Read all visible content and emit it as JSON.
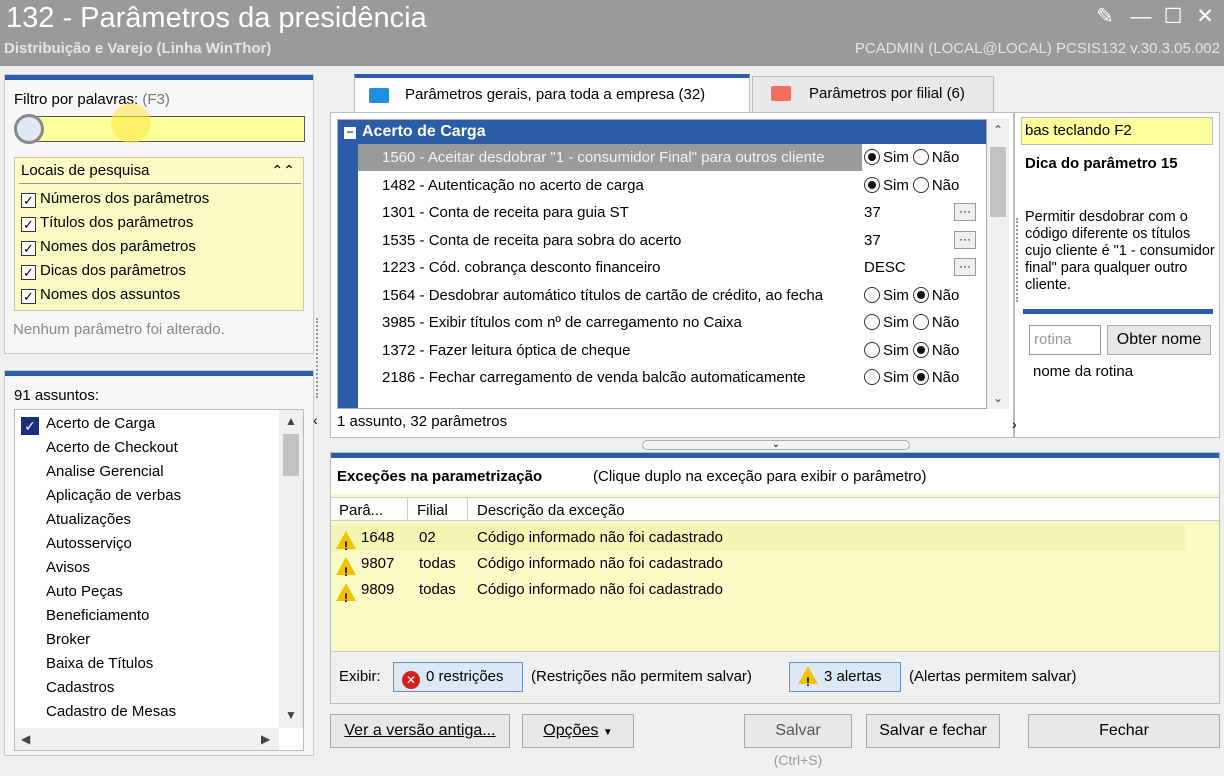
{
  "window": {
    "title": "132 - Parâmetros da presidência",
    "subtitle": "Distribuição e Varejo (Linha WinThor)",
    "info": "PCADMIN (LOCAL@LOCAL)   PCSIS132  v.30.3.05.002"
  },
  "filter": {
    "label": "Filtro por palavras:",
    "shortcut": "(F3)",
    "value": ""
  },
  "search_locations": {
    "title": "Locais de pesquisa",
    "items": [
      {
        "label": "Números dos parâmetros",
        "checked": true
      },
      {
        "label": "Títulos dos parâmetros",
        "checked": true
      },
      {
        "label": "Nomes dos parâmetros",
        "checked": true
      },
      {
        "label": "Dicas dos parâmetros",
        "checked": true
      },
      {
        "label": "Nomes dos assuntos",
        "checked": true
      }
    ]
  },
  "status_msg": "Nenhum parâmetro foi alterado.",
  "subjects": {
    "count_label": "91 assuntos:",
    "items": [
      "Acerto de Carga",
      "Acerto de Checkout",
      "Analise Gerencial",
      "Aplicação de verbas",
      "Atualizações",
      "Autosserviço",
      "Avisos",
      "Auto Peças",
      "Beneficiamento",
      "Broker",
      "Baixa de Títulos",
      "Cadastros",
      "Cadastro de Mesas"
    ]
  },
  "tabs": [
    {
      "label": "Parâmetros gerais, para toda a empresa",
      "count": "(32)"
    },
    {
      "label": "Parâmetros por filial",
      "count": "(6)"
    }
  ],
  "group": {
    "title": "Acerto de Carga"
  },
  "params": [
    {
      "text": "1560 - Aceitar desdobrar \"1 - consumidor Final\" para outros cliente",
      "type": "radio",
      "value": "Sim"
    },
    {
      "text": "1482 - Autenticação no acerto de carga",
      "type": "radio",
      "value": "Sim"
    },
    {
      "text": "1301 - Conta de receita para guia ST",
      "type": "field",
      "value": "37"
    },
    {
      "text": "1535 - Conta de receita para sobra do acerto",
      "type": "field",
      "value": "37"
    },
    {
      "text": "1223 - Cód. cobrança desconto financeiro",
      "type": "field",
      "value": "DESC"
    },
    {
      "text": "1564 - Desdobrar automático títulos de cartão de crédito, ao fecha",
      "type": "radio",
      "value": "Não"
    },
    {
      "text": "3985 - Exibir títulos com nº de carregamento no Caixa",
      "type": "radio",
      "value": "none"
    },
    {
      "text": "1372 - Fazer leitura óptica de cheque",
      "type": "radio",
      "value": "Não"
    },
    {
      "text": "2186 - Fechar carregamento de venda balcão automaticamente",
      "type": "radio",
      "value": "Não"
    }
  ],
  "labels": {
    "sim": "Sim",
    "nao": "Não",
    "dots": "···"
  },
  "params_summary": "1 assunto, 32 parâmetros",
  "hint": {
    "search_hint": "bas teclando F2",
    "title": "Dica do parâmetro 15",
    "text": "Permitir desdobrar com o código diferente os títulos cujo cliente é \"1 - consumidor final\" para qualquer outro cliente.",
    "routine_placeholder": "rotina",
    "get_name_button": "Obter nome",
    "routine_name_label": "nome da rotina"
  },
  "exceptions": {
    "title": "Exceções na parametrização",
    "note": "(Clique duplo na exceção para exibir o parâmetro)",
    "columns": [
      "Parâ...",
      "Filial",
      "Descrição da exceção"
    ],
    "rows": [
      {
        "param": "1648",
        "filial": "02",
        "desc": "Código informado não foi cadastrado"
      },
      {
        "param": "9807",
        "filial": "todas",
        "desc": "Código informado não foi cadastrado"
      },
      {
        "param": "9809",
        "filial": "todas",
        "desc": "Código informado não foi cadastrado"
      }
    ]
  },
  "show_bar": {
    "label": "Exibir:",
    "restrictions_button": "0 restrições",
    "restrictions_note": "(Restrições não permitem salvar)",
    "alerts_button": "3 alertas",
    "alerts_note": "(Alertas permitem salvar)"
  },
  "buttons": {
    "old_version": "Ver a versão antiga...",
    "options": "Opções",
    "save": "Salvar",
    "save_shortcut": "(Ctrl+S)",
    "save_close": "Salvar e fechar",
    "close": "Fechar"
  },
  "colors": {
    "accent": "#2a5ca8",
    "highlight": "#fbfbc6",
    "titlebar": "#9a9a9a"
  }
}
